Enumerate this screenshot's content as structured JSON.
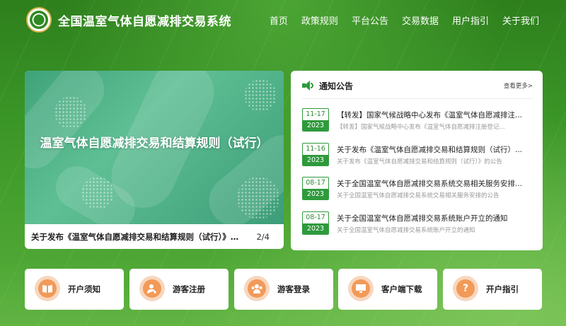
{
  "site": {
    "title": "全国温室气体自愿减排交易系统"
  },
  "nav": [
    "首页",
    "政策规则",
    "平台公告",
    "交易数据",
    "用户指引",
    "关于我们"
  ],
  "banner": {
    "headline": "温室气体自愿减排交易和结算规则（试行）",
    "caption": "关于发布《温室气体自愿减排交易和结算规则（试行）》的...",
    "page": "2/4"
  },
  "notice": {
    "title": "通知公告",
    "more": "查看更多>",
    "items": [
      {
        "md": "11-17",
        "year": "2023",
        "title": "【转发】国家气候战略中心发布《温室气体自愿减排注...",
        "sub": "【转发】国家气候战略中心发布《温室气体自愿减排注册登记..."
      },
      {
        "md": "11-16",
        "year": "2023",
        "title": "关于发布《温室气体自愿减排交易和结算规则（试行）...",
        "sub": "关于发布《温室气体自愿减排交易和结算规则（试行）》的公告"
      },
      {
        "md": "08-17",
        "year": "2023",
        "title": "关于全国温室气体自愿减排交易系统交易相关服务安排...",
        "sub": "关于全国温室气体自愿减排交易系统交易相关服务安排的公告"
      },
      {
        "md": "08-17",
        "year": "2023",
        "title": "关于全国温室气体自愿减排交易系统账户开立的通知",
        "sub": "关于全国温室气体自愿减排交易系统账户开立的通知"
      }
    ]
  },
  "quick_links": [
    {
      "label": "开户须知",
      "icon": "book-icon"
    },
    {
      "label": "游客注册",
      "icon": "user-add-icon"
    },
    {
      "label": "游客登录",
      "icon": "users-icon"
    },
    {
      "label": "客户端下载",
      "icon": "monitor-icon"
    },
    {
      "label": "开户指引",
      "icon": "question-icon"
    }
  ],
  "colors": {
    "primary_green": "#2e9a3c",
    "icon_orange": "#f29a58"
  }
}
